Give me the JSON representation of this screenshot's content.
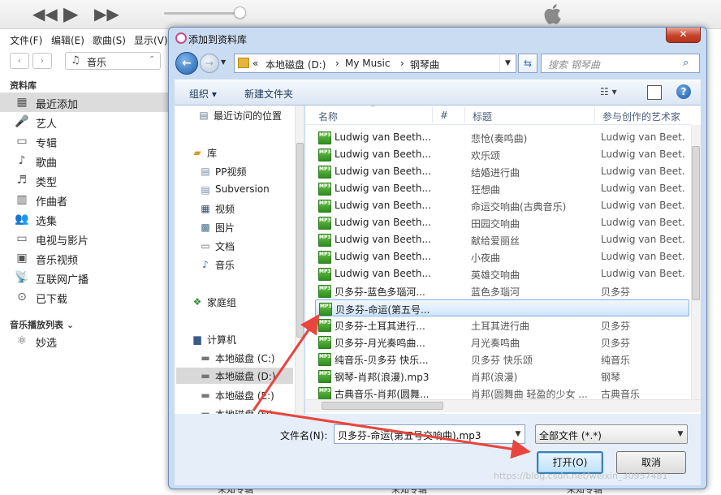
{
  "itunes": {
    "menu": [
      "文件(F)",
      "编辑(E)",
      "歌曲(S)",
      "显示(V)"
    ],
    "library_select": "音乐",
    "sidebar_header_library": "资料库",
    "sidebar_items": [
      {
        "label": "最近添加",
        "icon": "recent-icon"
      },
      {
        "label": "艺人",
        "icon": "artist-icon"
      },
      {
        "label": "专辑",
        "icon": "album-icon"
      },
      {
        "label": "歌曲",
        "icon": "note-icon"
      },
      {
        "label": "类型",
        "icon": "genre-icon"
      },
      {
        "label": "作曲者",
        "icon": "composer-icon"
      },
      {
        "label": "选集",
        "icon": "compilation-icon"
      },
      {
        "label": "电视与影片",
        "icon": "tv-icon"
      },
      {
        "label": "音乐视频",
        "icon": "music-video-icon"
      },
      {
        "label": "互联网广播",
        "icon": "radio-icon"
      },
      {
        "label": "已下载",
        "icon": "download-icon"
      }
    ],
    "sidebar_header_playlists": "音乐播放列表",
    "playlist_items": [
      {
        "label": "妙选",
        "icon": "genius-icon"
      }
    ],
    "footer_labels": [
      "未知专辑",
      "未知专辑",
      "未知专辑"
    ]
  },
  "dialog": {
    "title": "添加到资料库",
    "close": "✕",
    "path": [
      "«",
      "本地磁盘 (D:)",
      "›",
      "My Music",
      "›",
      "钢琴曲"
    ],
    "search_placeholder": "搜索 钢琴曲",
    "toolbar": {
      "organize": "组织 ▾",
      "new_folder": "新建文件夹"
    },
    "left_tree": [
      {
        "label": "最近访问的位置",
        "icon": "recent-places-icon"
      },
      {
        "label": "库",
        "icon": "library-icon"
      },
      {
        "label": "PP视频",
        "icon": "library-folder-icon"
      },
      {
        "label": "Subversion",
        "icon": "library-folder-icon"
      },
      {
        "label": "视频",
        "icon": "video-icon"
      },
      {
        "label": "图片",
        "icon": "picture-icon"
      },
      {
        "label": "文档",
        "icon": "document-icon"
      },
      {
        "label": "音乐",
        "icon": "music-icon"
      },
      {
        "label": "家庭组",
        "icon": "homegroup-icon"
      },
      {
        "label": "计算机",
        "icon": "computer-icon"
      },
      {
        "label": "本地磁盘 (C:)",
        "icon": "drive-icon"
      },
      {
        "label": "本地磁盘 (D:)",
        "icon": "drive-icon"
      },
      {
        "label": "本地磁盘 (E:)",
        "icon": "drive-icon"
      },
      {
        "label": "本地磁盘 (F:)",
        "icon": "drive-icon"
      }
    ],
    "columns": {
      "name": "名称",
      "number": "#",
      "title": "标题",
      "artist": "参与创作的艺术家"
    },
    "files": [
      {
        "name": "Ludwig van Beeth...",
        "title": "悲怆(奏鸣曲)",
        "artist": "Ludwig van Beet..."
      },
      {
        "name": "Ludwig van Beeth...",
        "title": "欢乐颂",
        "artist": "Ludwig van Beet..."
      },
      {
        "name": "Ludwig van Beeth...",
        "title": "结婚进行曲",
        "artist": "Ludwig van Beet..."
      },
      {
        "name": "Ludwig van Beeth...",
        "title": "狂想曲",
        "artist": "Ludwig van Beet..."
      },
      {
        "name": "Ludwig van Beeth...",
        "title": "命运交响曲(古典音乐)",
        "artist": "Ludwig van Beet..."
      },
      {
        "name": "Ludwig van Beeth...",
        "title": "田园交响曲",
        "artist": "Ludwig van Beet..."
      },
      {
        "name": "Ludwig van Beeth...",
        "title": "献给爱丽丝",
        "artist": "Ludwig van Beet..."
      },
      {
        "name": "Ludwig van Beeth...",
        "title": "小夜曲",
        "artist": "Ludwig van Beet..."
      },
      {
        "name": "Ludwig van Beeth...",
        "title": "英雄交响曲",
        "artist": "Ludwig van Beet..."
      },
      {
        "name": "贝多芬-蓝色多瑙河...",
        "title": "蓝色多瑙河",
        "artist": "贝多芬"
      },
      {
        "name": "贝多芬-命运(第五号...",
        "title": "",
        "artist": ""
      },
      {
        "name": "贝多芬-土耳其进行...",
        "title": "土耳其进行曲",
        "artist": "贝多芬"
      },
      {
        "name": "贝多芬-月光奏鸣曲...",
        "title": "月光奏鸣曲",
        "artist": "贝多芬"
      },
      {
        "name": "纯音乐-贝多芬 快乐...",
        "title": "贝多芬 快乐颂",
        "artist": "纯音乐"
      },
      {
        "name": "钢琴-肖邦(浪漫).mp3",
        "title": "肖邦(浪漫)",
        "artist": "钢琴"
      },
      {
        "name": "古典音乐-肖邦(圆舞...",
        "title": "肖邦(圆舞曲 轻盈的少女 ...",
        "artist": "古典音乐"
      }
    ],
    "filename_label": "文件名(N):",
    "filename_value": "贝多芬-命运(第五号交响曲).mp3",
    "filetype_value": "全部文件 (*.*)",
    "open_button": "打开(O)",
    "cancel_button": "取消"
  },
  "watermark": "https://blog.csdn.net/weixin_30957481",
  "colors": {
    "accent": "#3c7fb1",
    "arrow": "#e8453c"
  }
}
